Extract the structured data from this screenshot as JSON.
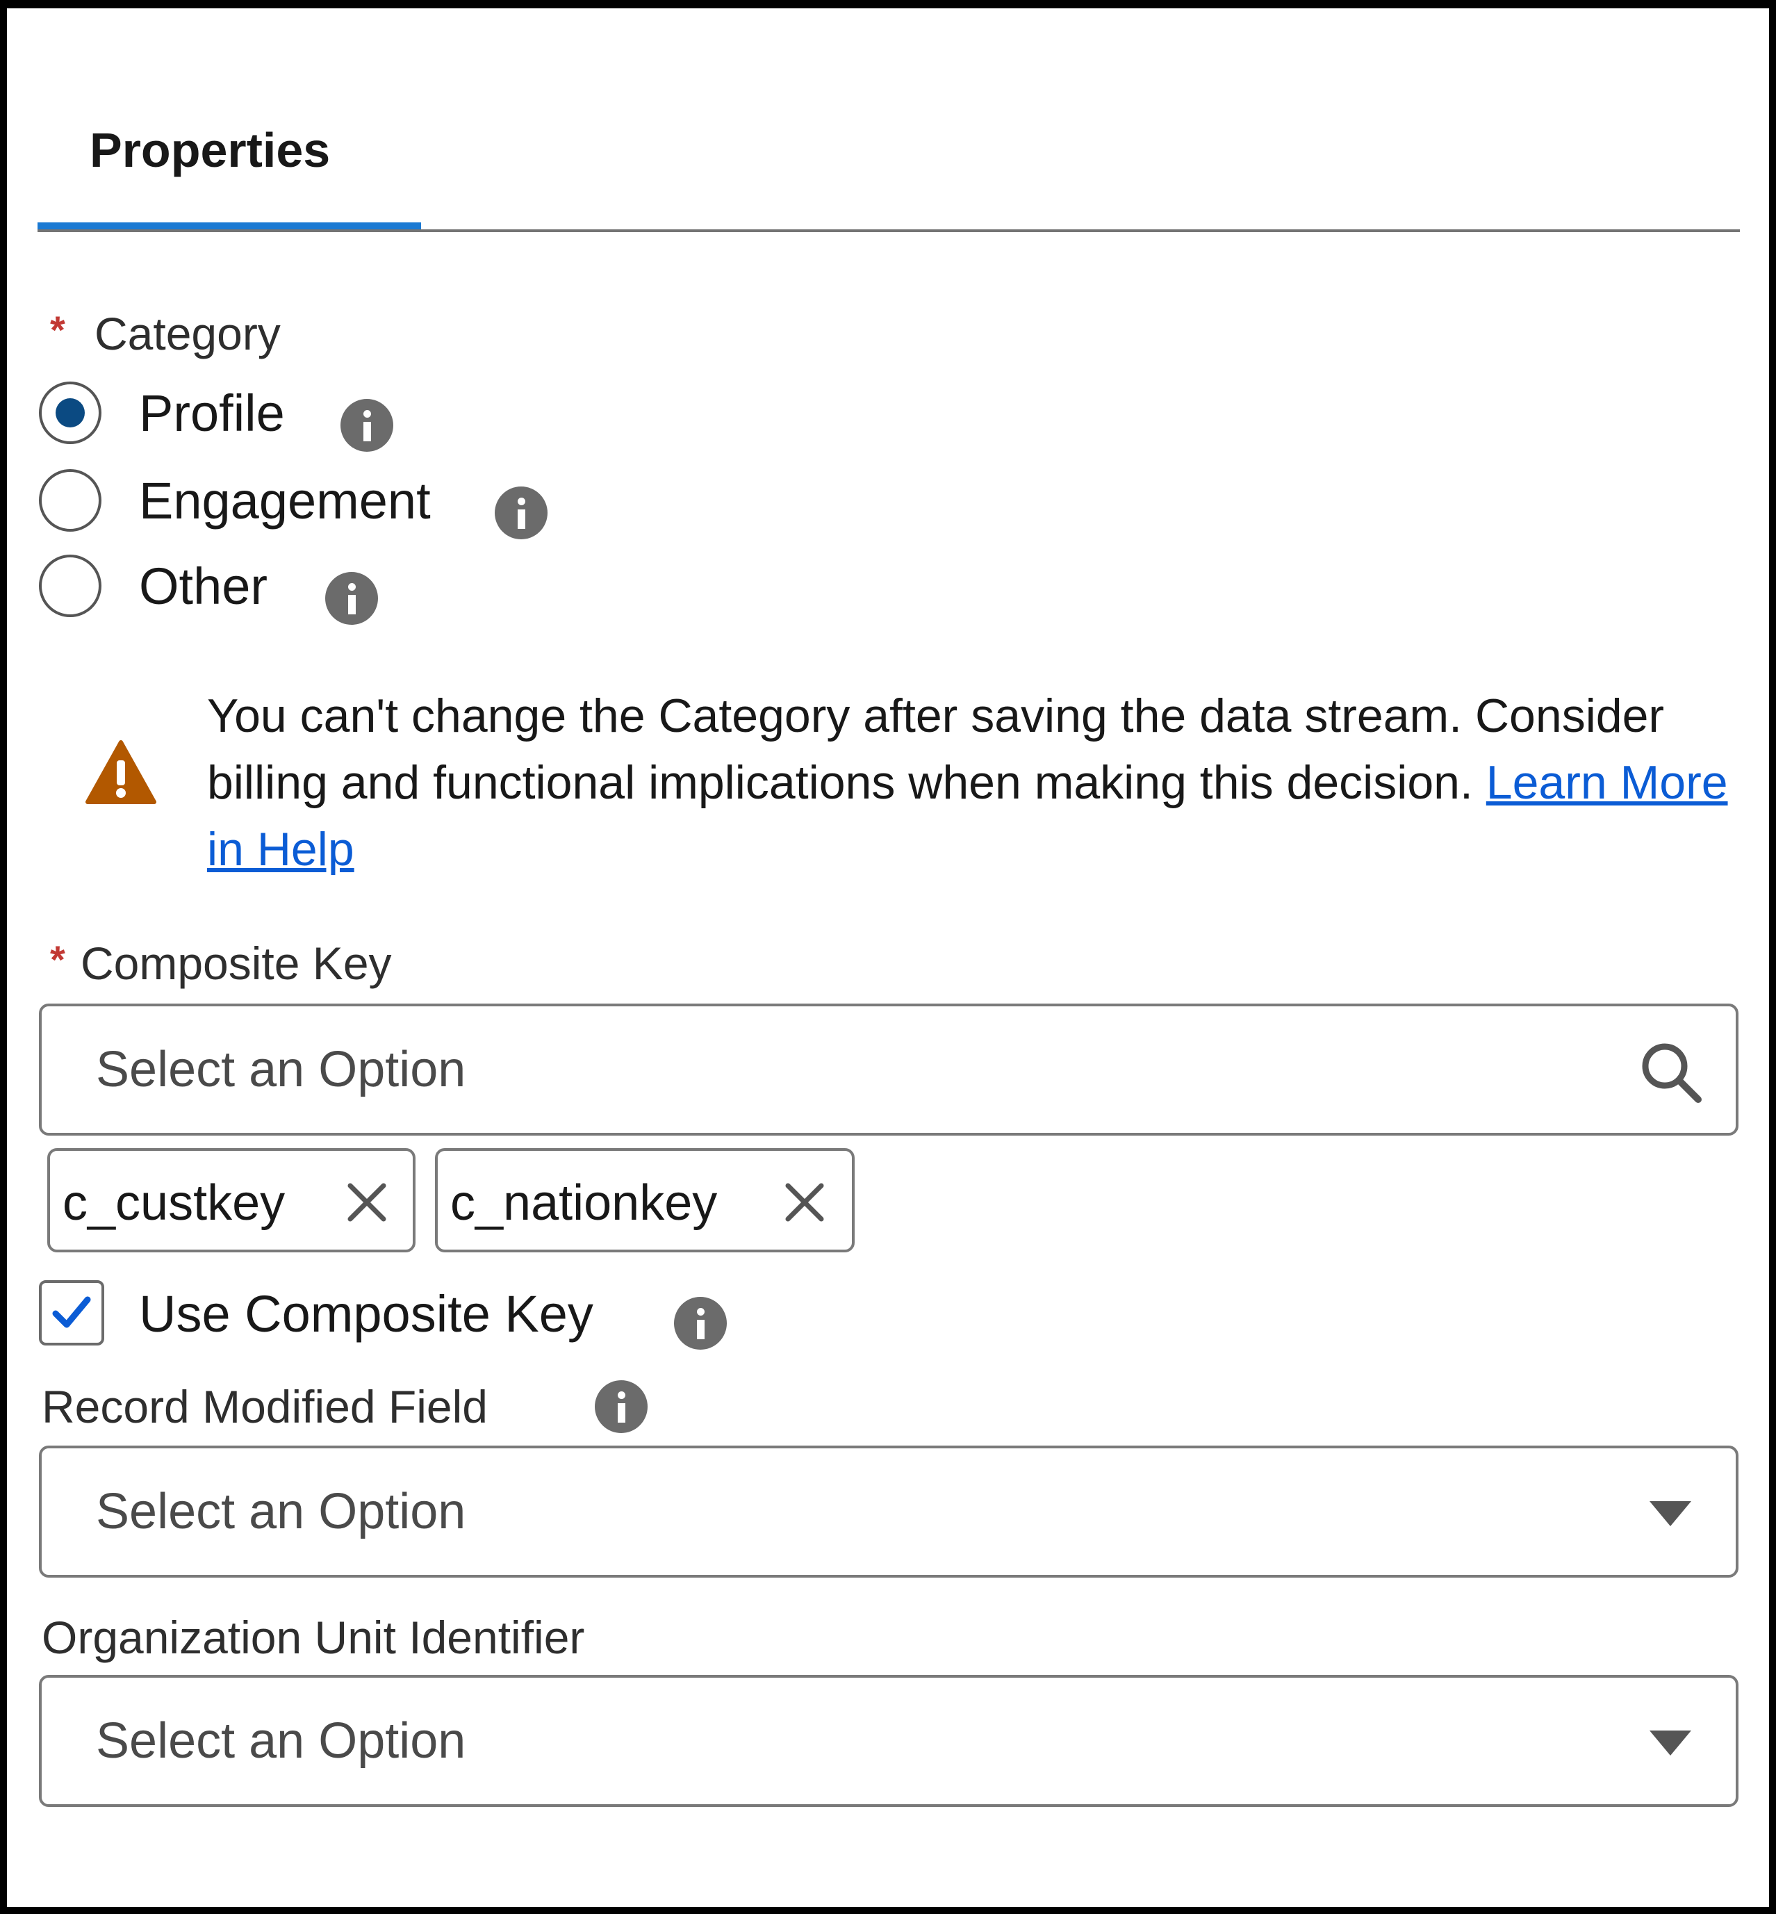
{
  "tabs": [
    {
      "label": "Properties",
      "active": true
    }
  ],
  "category": {
    "label": "Category",
    "required_marker": "*",
    "options": [
      {
        "label": "Profile",
        "checked": true
      },
      {
        "label": "Engagement",
        "checked": false
      },
      {
        "label": "Other",
        "checked": false
      }
    ]
  },
  "warning": {
    "text": "You can't change the Category after saving the data stream. Consider billing and functional implications when making this decision.",
    "link_text": "Learn More in Help",
    "icon": "warning-icon",
    "icon_color": "#b25800"
  },
  "composite_key": {
    "label": "Composite Key",
    "required_marker": "*",
    "placeholder": "Select an Option",
    "selected": [
      "c_custkey",
      "c_nationkey"
    ]
  },
  "use_composite_key": {
    "label": "Use Composite Key",
    "checked": true
  },
  "record_modified_field": {
    "label": "Record Modified Field",
    "placeholder": "Select an Option"
  },
  "organization_unit_identifier": {
    "label": "Organization Unit Identifier",
    "placeholder": "Select an Option"
  },
  "colors": {
    "accent": "#1b7ad3",
    "link": "#0b5cd5",
    "required": "#c23934",
    "radio_fill": "#0b4a82"
  }
}
